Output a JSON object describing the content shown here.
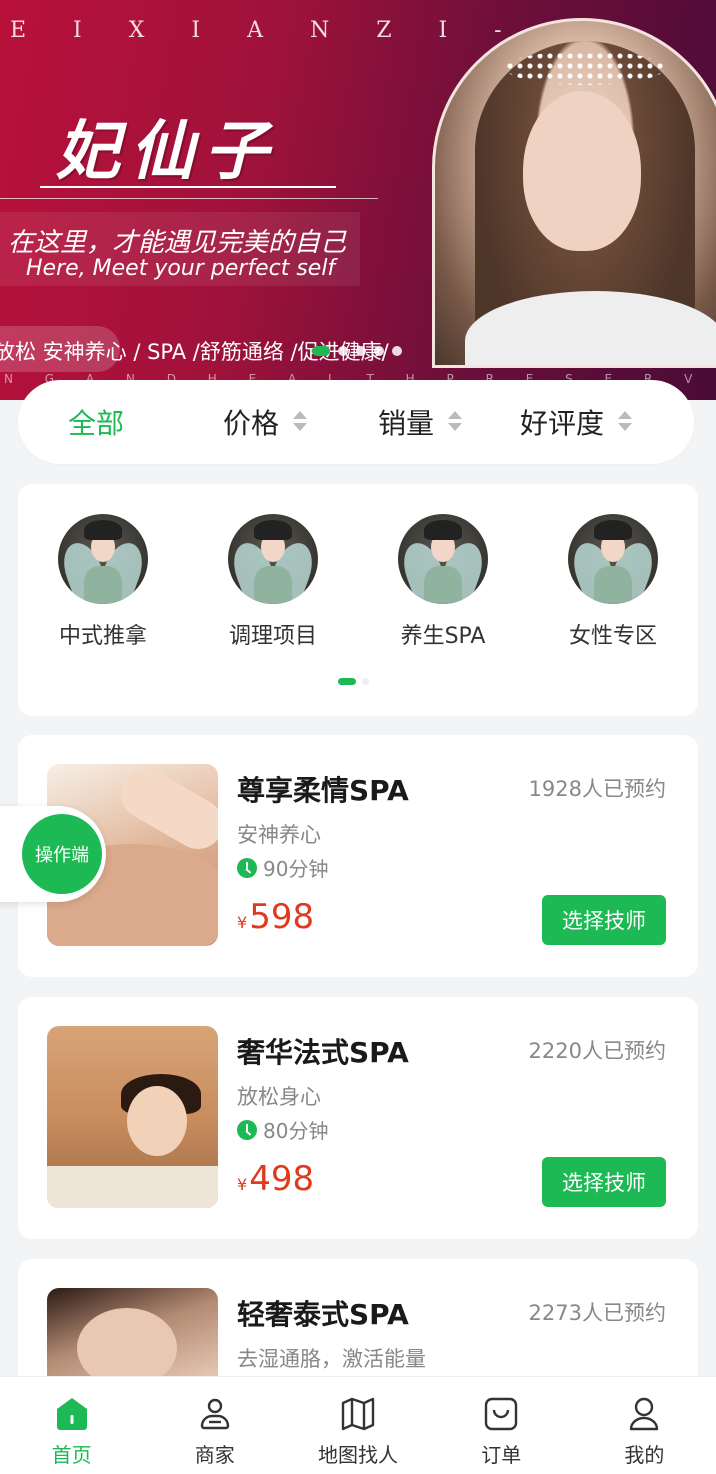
{
  "banner": {
    "top_letters": "E I  X I A N  Z I -",
    "brand": "妃仙子",
    "slogan_cn": "在这里，才能遇见完美的自己",
    "slogan_en": "Here, Meet your perfect self",
    "tags": "放松 安神养心 /   SPA   /舒筋通络 /促进健康/",
    "bottom_letters": "N G  A N D  H E A L T H  P R E S E R V A T I O N",
    "dots_total": 5,
    "dots_active": 0
  },
  "sort": {
    "all": "全部",
    "price": "价格",
    "sales": "销量",
    "rating": "好评度"
  },
  "categories": [
    {
      "label": "中式推拿"
    },
    {
      "label": "调理项目"
    },
    {
      "label": "养生SPA"
    },
    {
      "label": "女性专区"
    }
  ],
  "services": [
    {
      "title": "尊享柔情SPA",
      "booked": "1928人已预约",
      "subtitle": "安神养心",
      "duration": "90分钟",
      "currency": "¥",
      "price": "598",
      "button": "选择技师"
    },
    {
      "title": "奢华法式SPA",
      "booked": "2220人已预约",
      "subtitle": "放松身心",
      "duration": "80分钟",
      "currency": "¥",
      "price": "498",
      "button": "选择技师"
    },
    {
      "title": "轻奢泰式SPA",
      "booked": "2273人已预约",
      "subtitle": "去湿通胳，激活能量"
    }
  ],
  "operator": {
    "label": "操作端"
  },
  "tabbar": {
    "home": "首页",
    "merchant": "商家",
    "map": "地图找人",
    "orders": "订单",
    "mine": "我的"
  },
  "colors": {
    "accent": "#1db954",
    "price": "#e03a1e"
  }
}
